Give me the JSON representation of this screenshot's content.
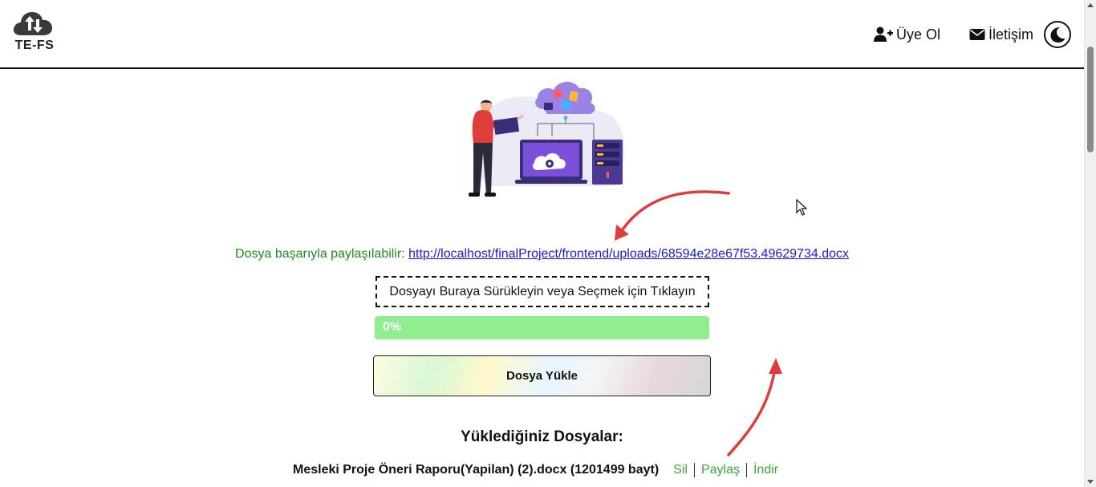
{
  "header": {
    "logo_text": "TE-FS",
    "nav": {
      "signup_label": "Üye Ol",
      "contact_label": "İletişim"
    },
    "icons": {
      "logo": "cloud-upload-download-icon",
      "signup": "user-plus-icon",
      "contact": "envelope-icon",
      "theme": "moon-icon"
    }
  },
  "share": {
    "label": "Dosya başarıyla paylaşılabilir:",
    "link": "http://localhost/finalProject/frontend/uploads/68594e28e67f53.49629734.docx"
  },
  "dropzone": {
    "label": "Dosyayı Buraya Sürükleyin veya Seçmek için Tıklayın"
  },
  "progress": {
    "label": "0%"
  },
  "upload_button": {
    "label": "Dosya Yükle"
  },
  "files": {
    "title": "Yüklediğiniz Dosyalar:",
    "items": [
      {
        "name": "Mesleki Proje Öneri Raporu(Yapilan) (2).docx (1201499 bayt)",
        "delete_label": "Sil",
        "share_label": "Paylaş",
        "download_label": "İndir"
      }
    ]
  },
  "colors": {
    "share_label": "#1f8a1f",
    "link": "#1a1ad6",
    "progress_fill": "#90ee90",
    "file_action": "#3aa83a",
    "annotation_arrow": "#e03c3c",
    "illustration_purple": "#7b4fd8"
  }
}
